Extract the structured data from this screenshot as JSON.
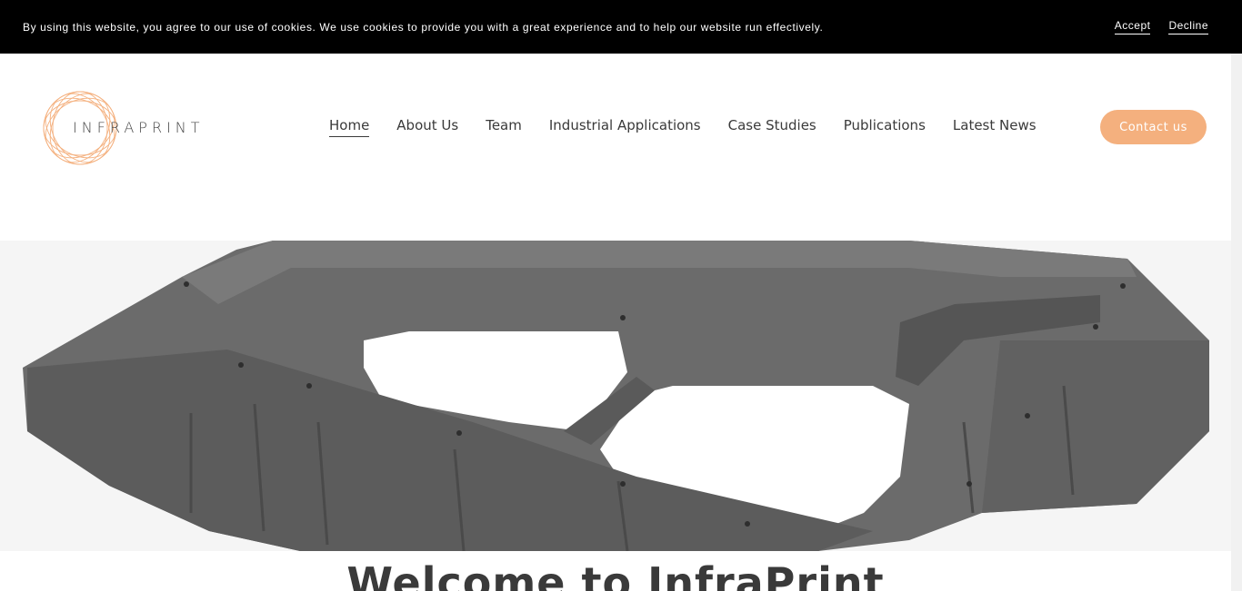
{
  "cookie_banner": {
    "text": "By using this website, you agree to our use of cookies. We use cookies to provide you with a great experience and to help our website run effectively.",
    "accept_label": "Accept",
    "decline_label": "Decline"
  },
  "header": {
    "logo_text": "INFRAPRINT",
    "nav": [
      {
        "label": "Home",
        "active": true
      },
      {
        "label": "About Us"
      },
      {
        "label": "Team"
      },
      {
        "label": "Industrial Applications"
      },
      {
        "label": "Case Studies"
      },
      {
        "label": "Publications"
      },
      {
        "label": "Latest News"
      }
    ],
    "contact_label": "Contact us"
  },
  "main": {
    "heading": "Welcome to InfraPrint"
  },
  "colors": {
    "accent": "#f4b07e",
    "cookie_bar": "#000000",
    "text": "#3a3a3a"
  }
}
